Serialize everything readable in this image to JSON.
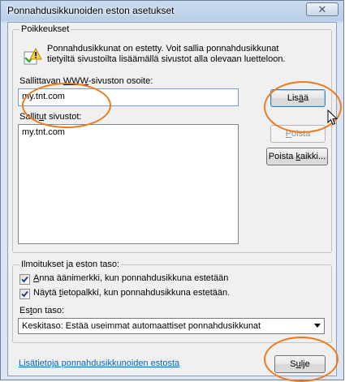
{
  "window": {
    "title": "Ponnahdusikkunoiden eston asetukset",
    "close_glyph": "✕"
  },
  "exceptions": {
    "group_label": "Poikkeukset",
    "info_text": "Ponnahdusikkunat on estetty. Voit sallia ponnahdusikkunat tietyiltä sivustoilta lisäämällä sivustot alla olevaan luetteloon.",
    "address_label_pre": "Sallittavan ",
    "address_label_ul": "WWW",
    "address_label_post": "-sivuston osoite:",
    "address_value": "my.tnt.com",
    "add_button_pre": "Lis",
    "add_button_ul": "ä",
    "add_button_post": "ä",
    "allowed_label_pre": "Sallit",
    "allowed_label_ul": "u",
    "allowed_label_post": "t sivustot:",
    "allowed_sites": [
      "my.tnt.com"
    ],
    "remove_button_pre": "",
    "remove_button_ul": "P",
    "remove_button_post": "oista",
    "remove_all_button_pre": "Poista ",
    "remove_all_button_ul": "k",
    "remove_all_button_post": "aikki..."
  },
  "notifications": {
    "group_label": "Ilmoitukset ja eston taso:",
    "sound_checkbox_pre": "",
    "sound_checkbox_ul": "A",
    "sound_checkbox_post": "nna äänimerkki, kun ponnahdusikkuna estetään",
    "sound_checked": true,
    "infobar_checkbox_pre": "Näytä ",
    "infobar_checkbox_ul": "t",
    "infobar_checkbox_post": "ietopalkki, kun ponnahdusikkuna estetään.",
    "infobar_checked": true,
    "level_label_pre": "Es",
    "level_label_ul": "t",
    "level_label_post": "on taso:",
    "level_value": "Keskitaso: Estää useimmat automaattiset ponnahdusikkunat"
  },
  "footer": {
    "learn_more_link": "Lisätietoja ponnahdusikkunoiden estosta",
    "close_button_pre": "S",
    "close_button_ul": "u",
    "close_button_post": "lje"
  },
  "colors": {
    "highlight_ellipse": "#ee7a1c",
    "link": "#0066cc"
  }
}
